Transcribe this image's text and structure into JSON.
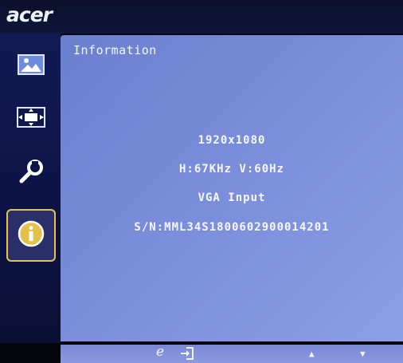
{
  "brand": {
    "logo_text": "acer"
  },
  "sidebar": {
    "items": [
      {
        "name": "picture",
        "icon": "picture-icon",
        "active": false
      },
      {
        "name": "osd-position",
        "icon": "position-arrows-icon",
        "active": false
      },
      {
        "name": "settings",
        "icon": "wrench-icon",
        "active": false
      },
      {
        "name": "information",
        "icon": "info-icon",
        "active": true
      }
    ]
  },
  "panel": {
    "title": "Information",
    "resolution": "1920x1080",
    "frequency": "H:67KHz V:60Hz",
    "input": "VGA Input",
    "serial": "S/N:MML34S1800602900014201"
  },
  "bottombar": {
    "keys": [
      {
        "name": "e-key",
        "icon": "acer-e-icon",
        "glyph": "e"
      },
      {
        "name": "input-key",
        "icon": "input-source-icon"
      },
      {
        "name": "up-key",
        "icon": "triangle-up-icon",
        "glyph": "▲"
      },
      {
        "name": "down-key",
        "icon": "triangle-down-icon",
        "glyph": "▼"
      }
    ]
  },
  "colors": {
    "panel": "#7a8dd8",
    "sidebar": "#0f1850",
    "active_border": "#e6c44a",
    "text": "#f6f7ff"
  }
}
